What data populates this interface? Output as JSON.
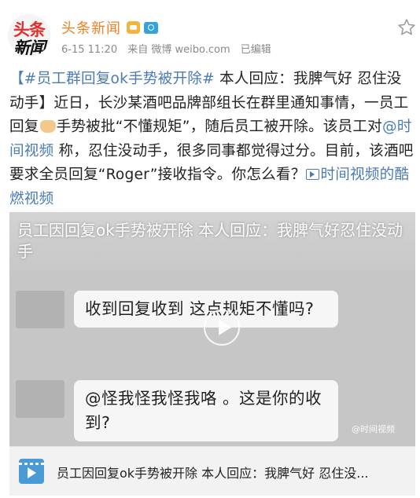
{
  "header": {
    "avatar_line1": "头条",
    "avatar_line2": "新闻",
    "account_name": "头条新闻",
    "time": "6-15 11:20",
    "source": "来自 微博 weibo.com",
    "edited": "已编辑",
    "icons": [
      "vip-crown-icon",
      "camera-badge-icon",
      "star-icon"
    ]
  },
  "post": {
    "topic": "【#员工群回复ok手势被开除#",
    "t1": " 本人回应：我脾气好 忍住没动手】近日，长沙某酒吧品牌部组长在群里通知事情，一员工回复",
    "emoji": "ok-hand-emoji",
    "t2": "手势被批“不懂规矩”，随后员工被开除。该员工对",
    "mention": "@时间视频",
    "t3": " 称，忍住没动手，很多同事都觉得过分。目前，该酒吧要求全员回复“Roger”接收指令。你怎么看？",
    "video_link": "时间视频的酷燃视频"
  },
  "video": {
    "caption": "员工因回复ok手势被开除 本人回应：我脾气好忍住没动手",
    "bubble1": "收到回复收到  这点规矩不懂吗?",
    "bubble2": "@怪我怪我怪我咯 。这是你的收到?",
    "watermark": "@时间视频"
  },
  "card": {
    "title": "员工因回复ok手势被开除 本人回应：我脾气好 忍住没...",
    "icon": "video-icon"
  }
}
